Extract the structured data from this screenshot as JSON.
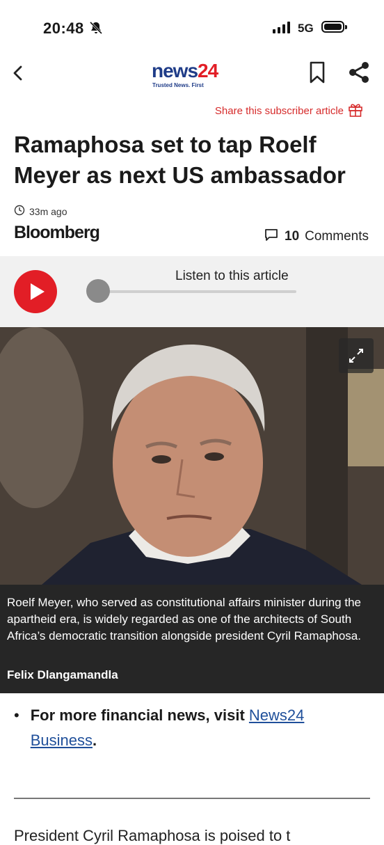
{
  "status_bar": {
    "time": "20:48",
    "network": "5G"
  },
  "nav": {
    "logo_main": "news",
    "logo_num": "24",
    "logo_tagline": "Trusted News. First"
  },
  "subscriber_share": "Share this subscriber article",
  "article": {
    "headline": "Ramaphosa set to tap Roelf Meyer as next US ambassador",
    "time_ago": "33m ago",
    "source": "Bloomberg",
    "comments_count": "10",
    "comments_label": "Comments"
  },
  "audio": {
    "label": "Listen to this article",
    "progress": 0
  },
  "image": {
    "caption": "Roelf Meyer, who served as constitutional affairs minister during the apartheid era, is widely regarded as one of the architects of South Africa’s democratic transition alongside president Cyril Ramaphosa.",
    "credit": "Felix Dlangamandla"
  },
  "body": {
    "bullet_prefix": "For more financial news, visit ",
    "bullet_link": "News24 Business",
    "bullet_suffix": ".",
    "next_paragraph_start": "President Cyril Ramaphosa is poised to t"
  },
  "colors": {
    "brand_red": "#e21e26",
    "brand_blue": "#1f3c88"
  },
  "icons": [
    "back-chevron-icon",
    "bookmark-icon",
    "share-icon",
    "gift-icon",
    "clock-icon",
    "comment-icon",
    "play-icon",
    "expand-icon",
    "bell-muted-icon"
  ]
}
